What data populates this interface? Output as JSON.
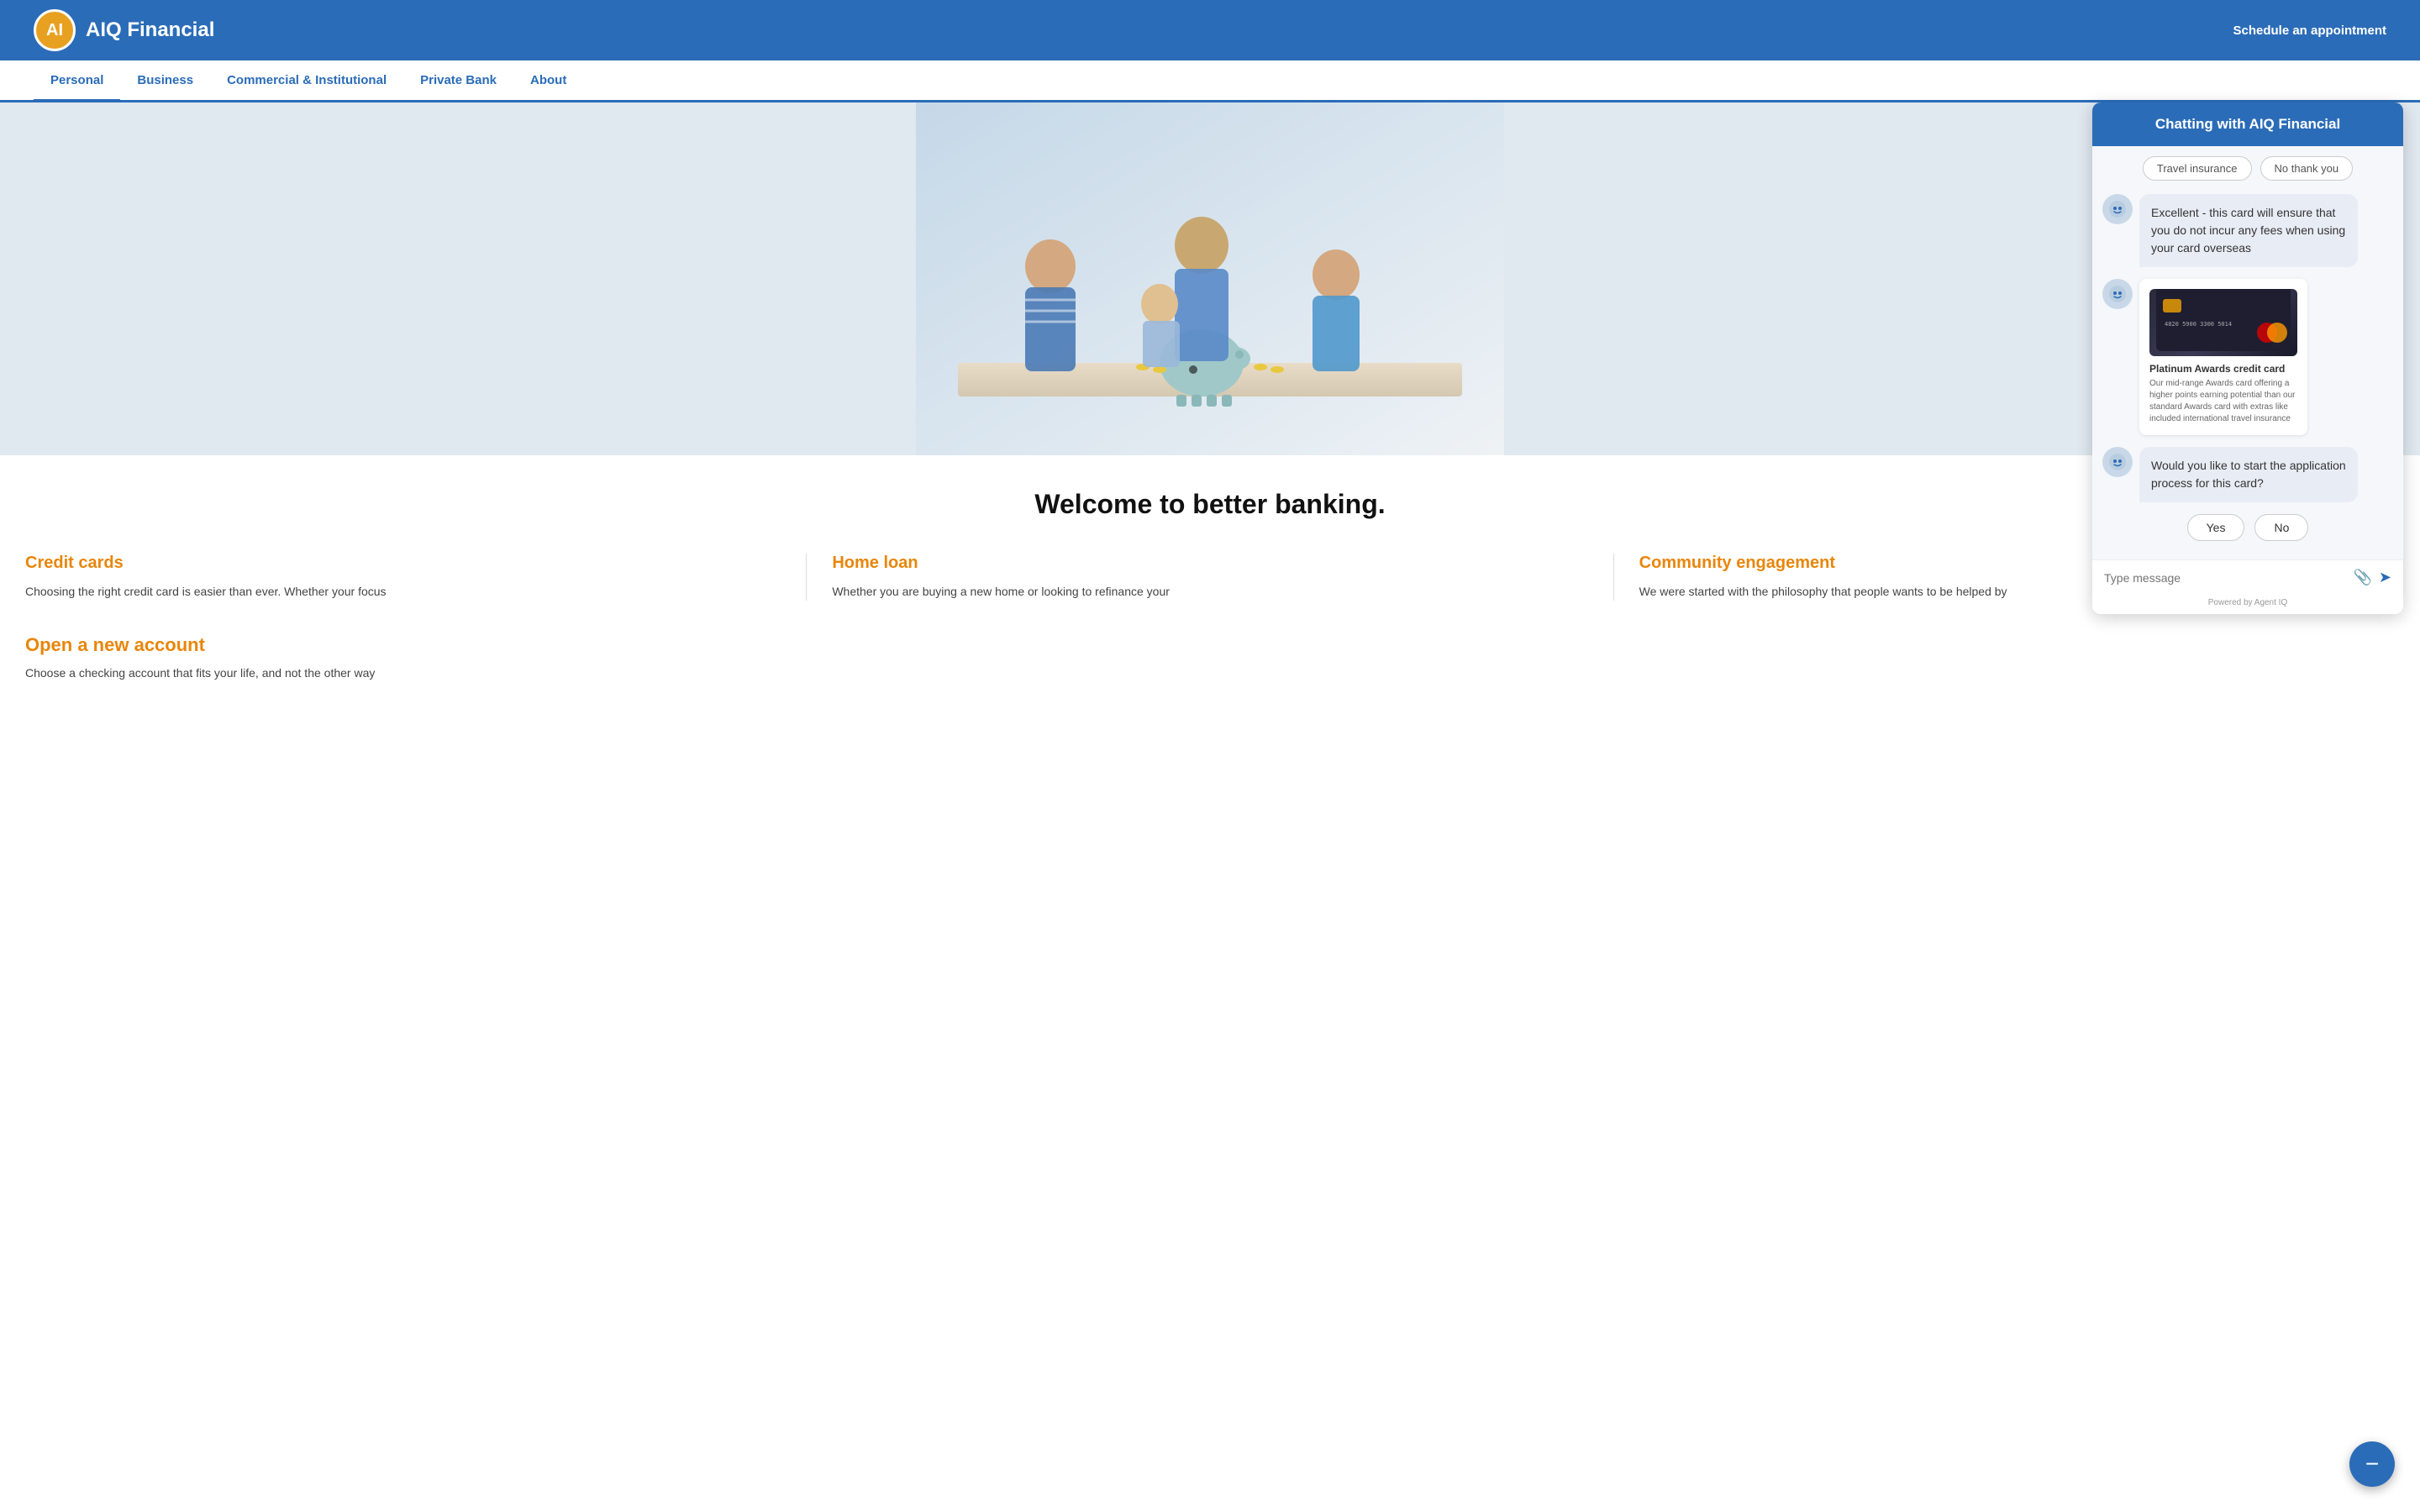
{
  "header": {
    "logo_letter": "AI",
    "logo_name": "AIQ Financial",
    "schedule_btn": "Schedule an appointment"
  },
  "nav": {
    "items": [
      {
        "label": "Personal",
        "active": true
      },
      {
        "label": "Business",
        "active": false
      },
      {
        "label": "Commercial & Institutional",
        "active": false
      },
      {
        "label": "Private Bank",
        "active": false
      },
      {
        "label": "About",
        "active": false
      }
    ]
  },
  "hero": {
    "alt": "Family with piggy bank"
  },
  "welcome": {
    "heading": "Welcome to better banking."
  },
  "cards": [
    {
      "title": "Credit cards",
      "text": "Choosing the right credit card is easier than ever. Whether your focus"
    },
    {
      "title": "Home loan",
      "text": "Whether you are buying a new home or looking to refinance your"
    },
    {
      "title": "Community engagement",
      "text": "We were started with the philosophy that people wants to be helped by"
    }
  ],
  "open_account": {
    "title": "Open a new account",
    "text": "Choose a checking account that fits your life, and not the other way"
  },
  "chat": {
    "header_title": "Chatting with AIQ Financial",
    "quick_replies": [
      {
        "label": "Travel insurance"
      },
      {
        "label": "No thank you"
      }
    ],
    "messages": [
      {
        "type": "bot",
        "text": "Excellent - this card will ensure that you do not incur any fees when using your card overseas"
      },
      {
        "type": "bot_card",
        "card": {
          "name": "Platinum Awards credit card",
          "description": "Our mid-range Awards card offering a higher points earning potential than our standard Awards card with extras like included international travel insurance"
        }
      },
      {
        "type": "bot",
        "text": "Would you like to start the application process for this card?"
      }
    ],
    "action_buttons": [
      {
        "label": "Yes"
      },
      {
        "label": "No"
      }
    ],
    "input_placeholder": "Type message",
    "footer": "Powered by Agent IQ"
  },
  "fab": {
    "icon": "−"
  }
}
